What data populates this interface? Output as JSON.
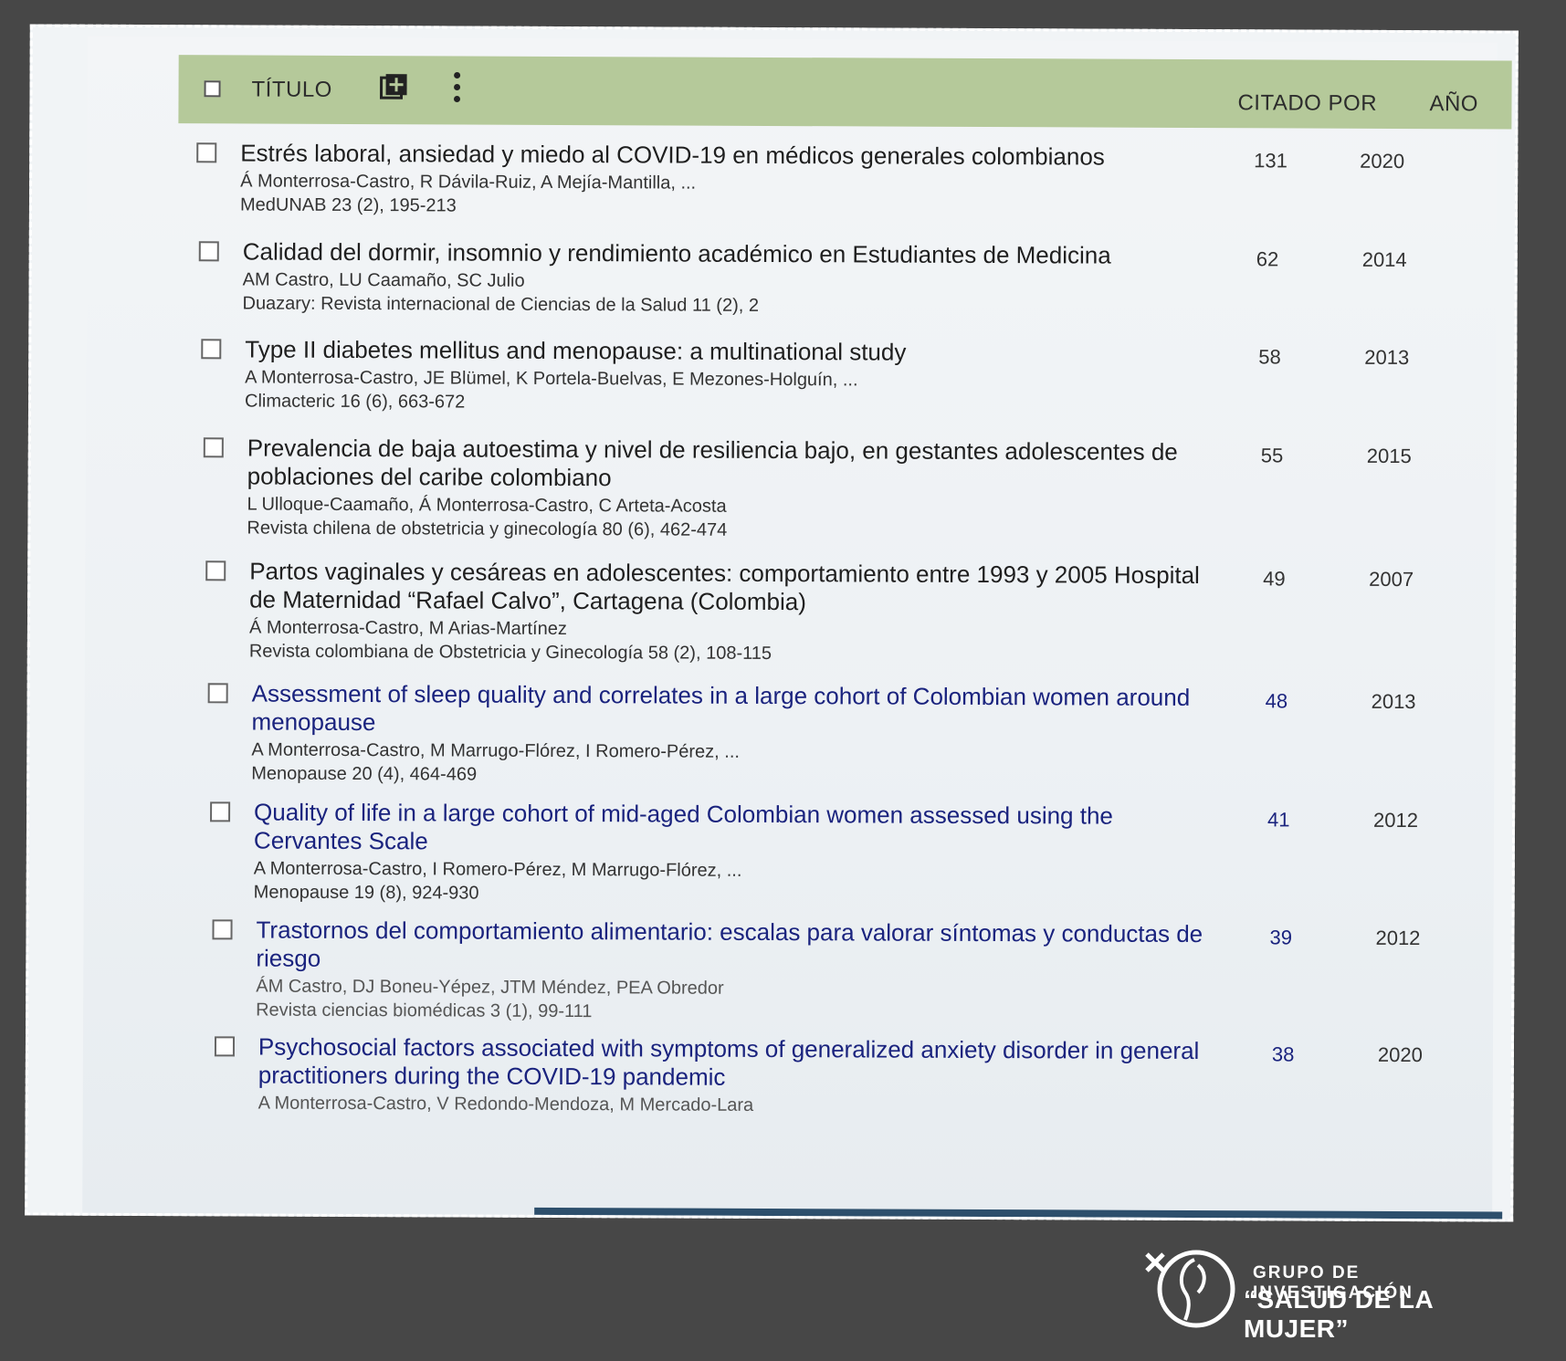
{
  "header": {
    "title_label": "TÍTULO",
    "cited_label": "CITADO POR",
    "year_label": "AÑO",
    "add_icon": "add-box-icon",
    "more_icon": "more-vertical-icon"
  },
  "articles": [
    {
      "title": "Estrés laboral, ansiedad y miedo al COVID-19 en médicos generales colombianos",
      "authors": "Á Monterrosa-Castro, R Dávila-Ruiz, A Mejía-Mantilla, ...",
      "venue": "MedUNAB 23 (2), 195-213",
      "cited_by": "131",
      "year": "2020"
    },
    {
      "title": "Calidad del dormir, insomnio y rendimiento académico en Estudiantes de Medicina",
      "authors": "AM Castro, LU Caamaño, SC Julio",
      "venue": "Duazary: Revista internacional de Ciencias de la Salud 11 (2), 2",
      "cited_by": "62",
      "year": "2014"
    },
    {
      "title": "Type II diabetes mellitus and menopause: a multinational study",
      "authors": "A Monterrosa-Castro, JE Blümel, K Portela-Buelvas, E Mezones-Holguín, ...",
      "venue": "Climacteric 16 (6), 663-672",
      "cited_by": "58",
      "year": "2013"
    },
    {
      "title": "Prevalencia de baja autoestima y nivel de resiliencia bajo, en gestantes adolescentes de poblaciones del caribe colombiano",
      "authors": "L Ulloque-Caamaño, Á Monterrosa-Castro, C Arteta-Acosta",
      "venue": "Revista chilena de obstetricia y ginecología 80 (6), 462-474",
      "cited_by": "55",
      "year": "2015"
    },
    {
      "title": "Partos vaginales y cesáreas en adolescentes: comportamiento entre 1993 y 2005 Hospital de Maternidad “Rafael Calvo”, Cartagena (Colombia)",
      "authors": "Á Monterrosa-Castro, M Arias-Martínez",
      "venue": "Revista colombiana de Obstetricia y Ginecología 58 (2), 108-115",
      "cited_by": "49",
      "year": "2007"
    },
    {
      "title": "Assessment of sleep quality and correlates in a large cohort of Colombian women around menopause",
      "authors": "A Monterrosa-Castro, M Marrugo-Flórez, I Romero-Pérez, ...",
      "venue": "Menopause 20 (4), 464-469",
      "cited_by": "48",
      "year": "2013"
    },
    {
      "title": "Quality of life in a large cohort of mid-aged Colombian women assessed using the Cervantes Scale",
      "authors": "A Monterrosa-Castro, I Romero-Pérez, M Marrugo-Flórez, ...",
      "venue": "Menopause 19 (8), 924-930",
      "cited_by": "41",
      "year": "2012"
    },
    {
      "title": "Trastornos del comportamiento alimentario: escalas para valorar síntomas y conductas de riesgo",
      "authors": "ÁM Castro, DJ Boneu-Yépez, JTM Méndez, PEA Obredor",
      "venue": "Revista ciencias biomédicas 3 (1), 99-111",
      "cited_by": "39",
      "year": "2012"
    },
    {
      "title": "Psychosocial factors associated with symptoms of generalized anxiety disorder in general practitioners during the COVID-19 pandemic",
      "authors": "A Monterrosa-Castro, V Redondo-Mendoza, M Mercado-Lara",
      "venue": "",
      "cited_by": "38",
      "year": "2020"
    }
  ],
  "logo": {
    "line1": "GRUPO DE INVESTIGACIÓN",
    "line2": "“SALUD DE LA MUJER”",
    "icon": "salud-mujer-logo-icon"
  },
  "colors": {
    "header_bar": "#b5c99a",
    "link_blue": "#1a237e",
    "background": "#474747"
  }
}
